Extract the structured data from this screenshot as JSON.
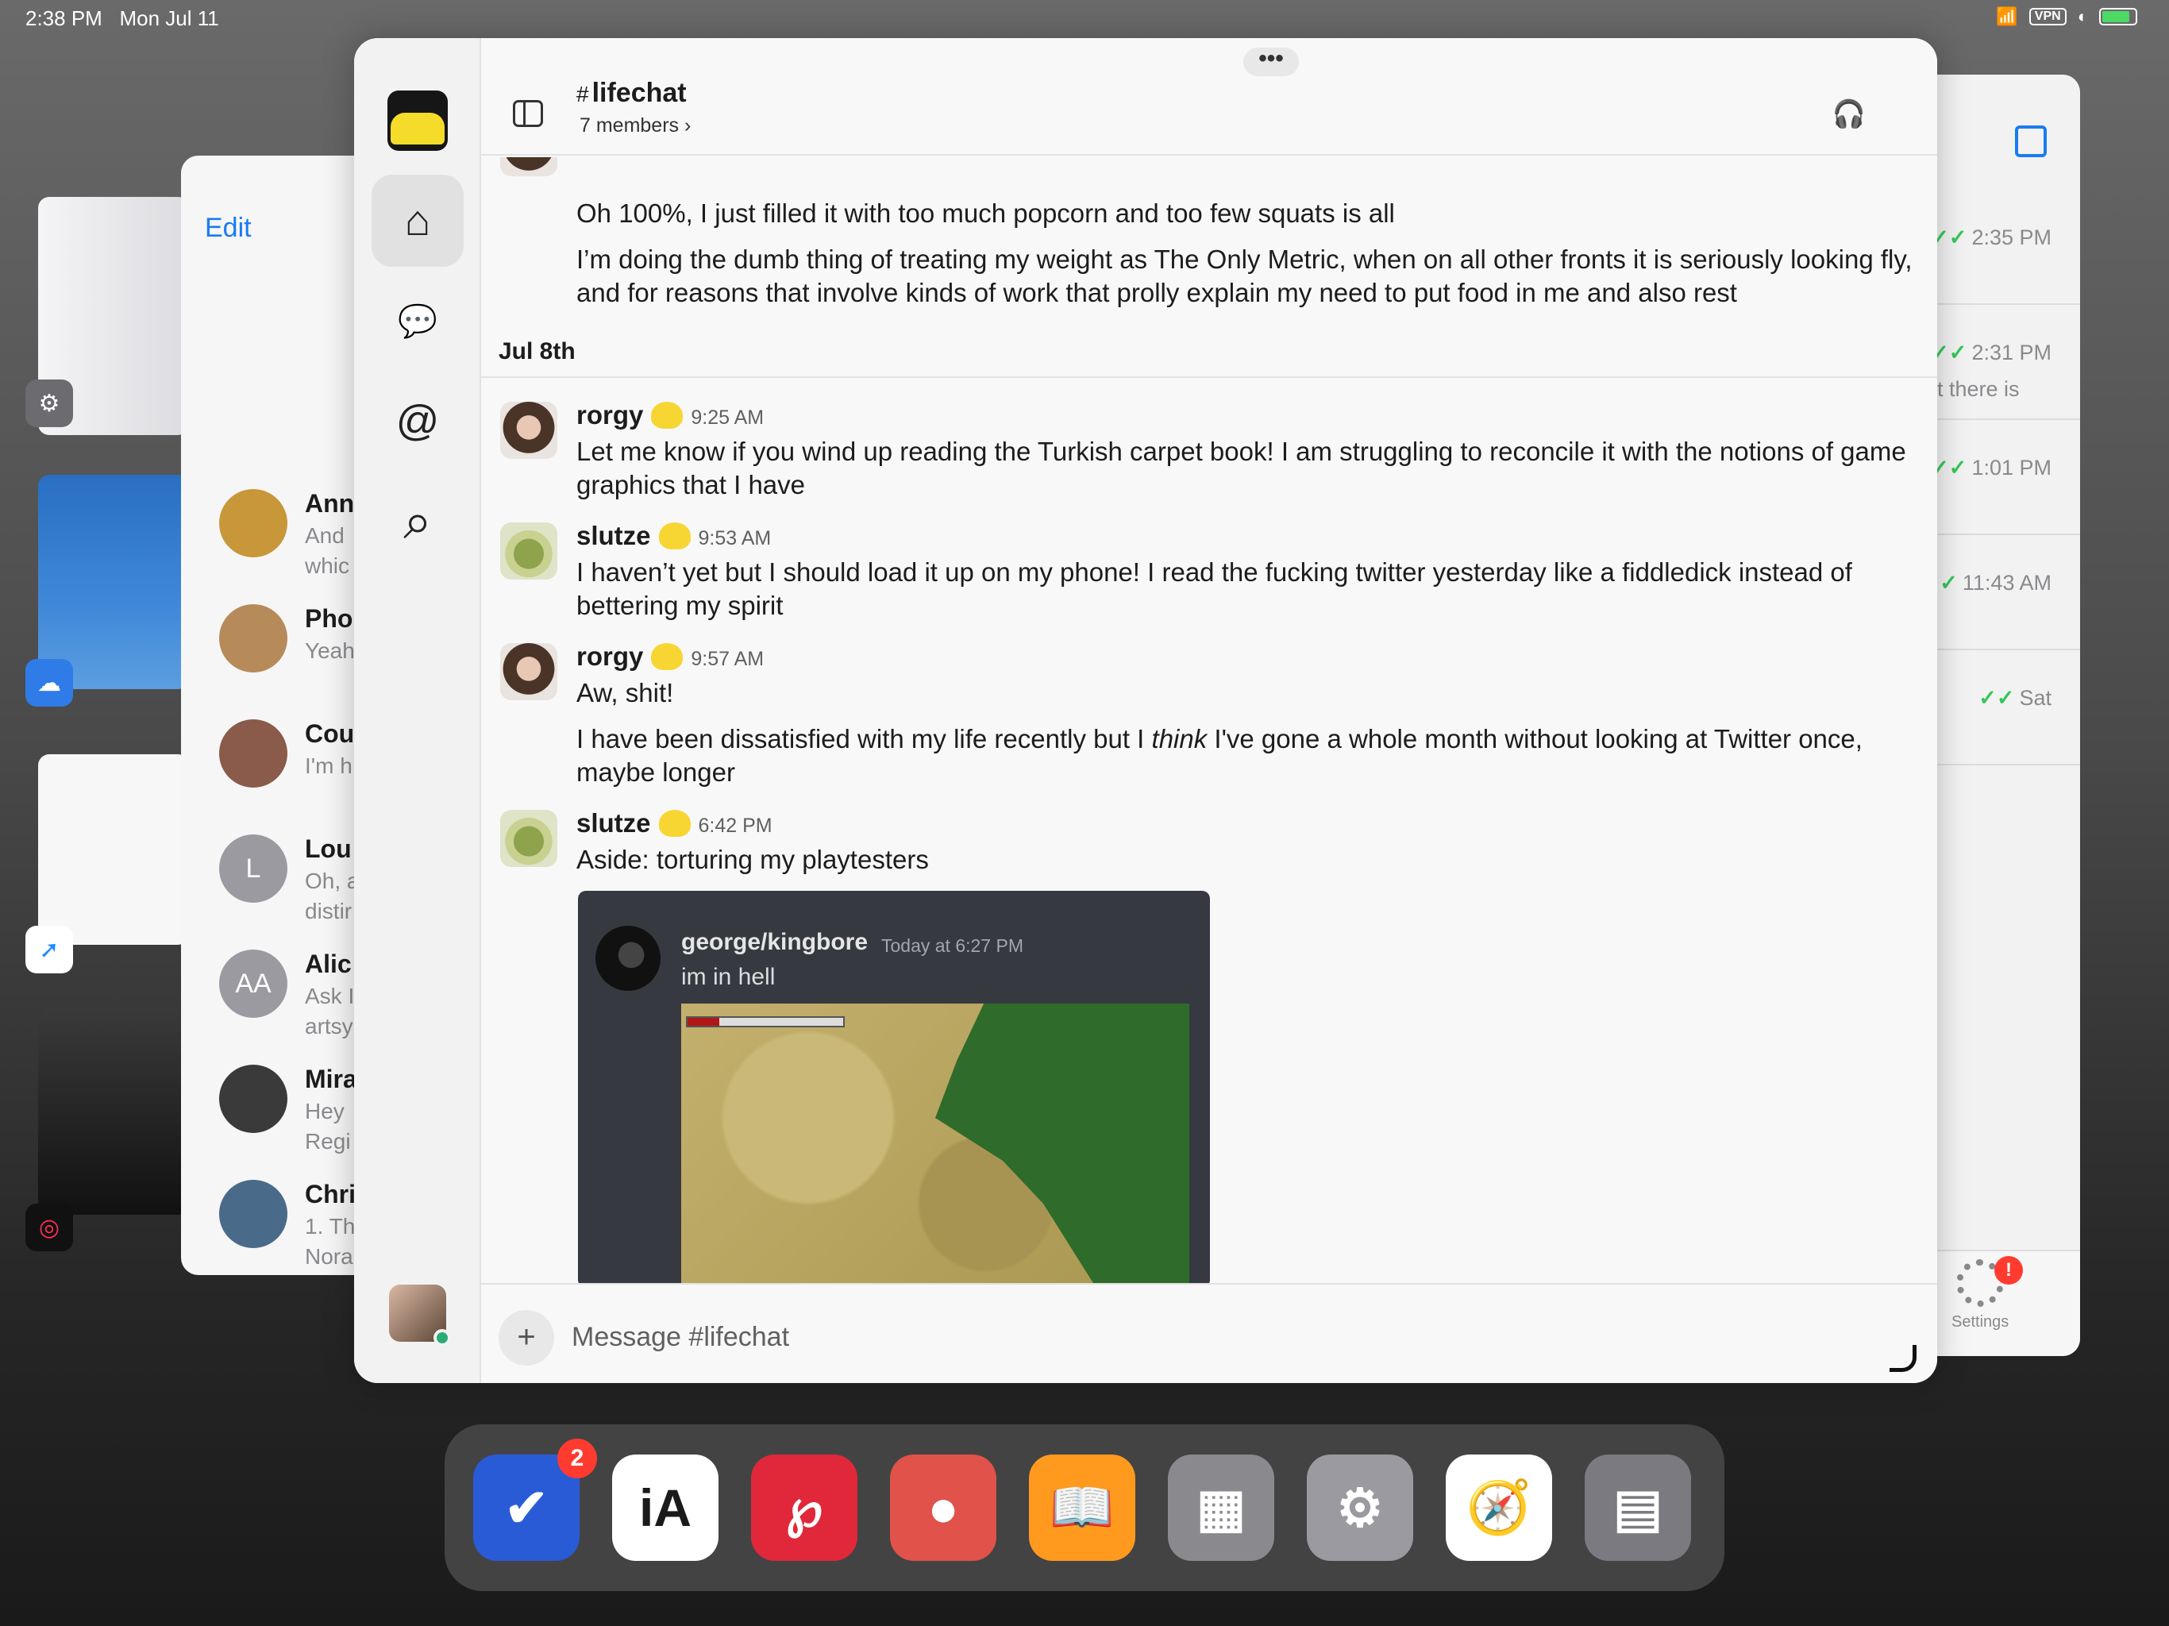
{
  "status_bar": {
    "time": "2:38 PM",
    "date": "Mon Jul 11",
    "vpn": "VPN"
  },
  "messages_app": {
    "edit_label": "Edit",
    "conversations": [
      {
        "name": "Ann",
        "preview_lines": [
          "And",
          "whic"
        ],
        "avatar_color": "#c7973a"
      },
      {
        "name": "Pho",
        "preview_lines": [
          "Yeah"
        ],
        "avatar_color": "#b78a5a"
      },
      {
        "name": "Cou",
        "preview_lines": [
          "I'm h"
        ],
        "avatar_color": "#8a5a4a"
      },
      {
        "name": "Lou",
        "preview_lines": [
          "Oh, a",
          "distir"
        ],
        "avatar_initials": "L",
        "avatar_color": "#9a9aa0"
      },
      {
        "name": "Alic",
        "preview_lines": [
          "Ask I",
          "artsy"
        ],
        "avatar_initials": "AA",
        "avatar_color": "#9a9aa0"
      },
      {
        "name": "Mira",
        "preview_lines": [
          "Hey",
          "Regi"
        ],
        "avatar_color": "#3a3a3a"
      },
      {
        "name": "Chri",
        "preview_lines": [
          "1. Th",
          "Nora"
        ],
        "avatar_color": "#4a6a8a"
      }
    ]
  },
  "settings_app": {
    "rows": [
      {
        "time": "2:35 PM",
        "text": ""
      },
      {
        "time": "2:31 PM",
        "text": "t there is"
      },
      {
        "time": "1:01 PM",
        "text": ""
      },
      {
        "time": "11:43 AM",
        "text": ""
      },
      {
        "time": "Sat",
        "text": ""
      }
    ],
    "tab_label": "Settings",
    "badge": "!"
  },
  "slack": {
    "more_dots": "•••",
    "channel": {
      "hash": "#",
      "name": "lifechat",
      "members": "7 members ›"
    },
    "nav": {
      "home_icon": "⌂",
      "dms_icon": "💬",
      "mentions_icon": "@",
      "search_icon": "⌕"
    },
    "headphones_icon": "🎧",
    "earlier_lines": [
      "Oh 100%, I just filled it with too much popcorn and too few squats is all",
      "I’m doing the dumb thing of treating my weight as The Only Metric, when on all other fronts it is seriously looking fly, and for reasons that involve kinds of work that prolly explain my need to put food in me and also rest"
    ],
    "day_divider": "Jul 8th",
    "messages": [
      {
        "author": "rorgy",
        "time": "9:25 AM",
        "lines": [
          "Let me know if you wind up reading the Turkish carpet book! I am struggling to reconcile it with the notions of game graphics that I have"
        ]
      },
      {
        "author": "slutze",
        "time": "9:53 AM",
        "lines": [
          "I haven’t yet but I should load it up on my phone! I read the fucking twitter yesterday like a fiddledick instead of bettering my spirit"
        ]
      },
      {
        "author": "rorgy",
        "time": "9:57 AM",
        "lines": [
          "Aw, shit!"
        ],
        "second_line_before": "I have been dissatisfied with my life recently but I ",
        "second_line_em": "think",
        "second_line_after": " I've gone a whole month without looking at Twitter once, maybe longer"
      },
      {
        "author": "slutze",
        "time": "6:42 PM",
        "lines": [
          "Aside: torturing my playtesters"
        ]
      }
    ],
    "embed": {
      "author": "george/kingbore",
      "time": "Today at 6:27 PM",
      "text": "im in hell"
    },
    "composer": {
      "plus_icon": "+",
      "placeholder": "Message #lifechat"
    }
  },
  "dock": {
    "apps": [
      {
        "name": "OmniFocus",
        "glyph": "✔",
        "bg": "#2a5bd7",
        "badge": "2"
      },
      {
        "name": "iA Writer",
        "glyph": "iA",
        "bg": "#ffffff"
      },
      {
        "name": "Peloton",
        "glyph": "℘",
        "bg": "#e0283a"
      },
      {
        "name": "Record",
        "glyph": "●",
        "bg": "#e0524a"
      },
      {
        "name": "Books",
        "glyph": "📖",
        "bg": "#ff9a1f"
      },
      {
        "name": "Folder",
        "glyph": "▦",
        "bg": "#8a8a8e"
      },
      {
        "name": "Settings",
        "glyph": "⚙",
        "bg": "#9a9aa0"
      },
      {
        "name": "Safari",
        "glyph": "🧭",
        "bg": "#ffffff"
      },
      {
        "name": "Recent Apps",
        "glyph": "▤",
        "bg": "#7a7a80"
      }
    ]
  }
}
